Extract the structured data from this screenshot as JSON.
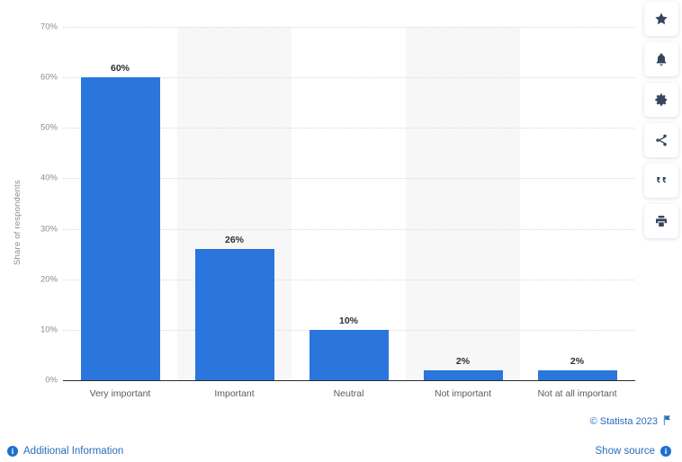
{
  "chart_data": {
    "type": "bar",
    "title": "",
    "subtitle": "",
    "xlabel": "",
    "ylabel": "Share of respondents",
    "categories": [
      "Very important",
      "Important",
      "Neutral",
      "Not important",
      "Not at all important"
    ],
    "values": [
      60,
      26,
      10,
      2,
      2
    ],
    "value_labels": [
      "60%",
      "26%",
      "10%",
      "2%",
      "2%"
    ],
    "ylim": [
      0,
      70
    ],
    "y_ticks": [
      0,
      10,
      20,
      30,
      40,
      50,
      60,
      70
    ],
    "y_tick_labels": [
      "0%",
      "10%",
      "20%",
      "30%",
      "40%",
      "50%",
      "60%",
      "70%"
    ],
    "grid": true,
    "legend": null,
    "bar_color": "#2a76dc",
    "band_color": "#f7f7f8",
    "gridline_color": "#d8d8dc",
    "axis_color": "#2c2c2c"
  },
  "icon_rail": {
    "items": [
      {
        "name": "star-icon",
        "label": "Favorite"
      },
      {
        "name": "bell-icon",
        "label": "Notifications"
      },
      {
        "name": "gear-icon",
        "label": "Settings"
      },
      {
        "name": "share-icon",
        "label": "Share"
      },
      {
        "name": "quote-icon",
        "label": "Citation"
      },
      {
        "name": "print-icon",
        "label": "Print"
      }
    ]
  },
  "footer": {
    "copyright": "© Statista 2023",
    "flag_icon": "flag-icon",
    "additional_information": "Additional Information",
    "show_source": "Show source",
    "link_color": "#2a6ebb"
  }
}
